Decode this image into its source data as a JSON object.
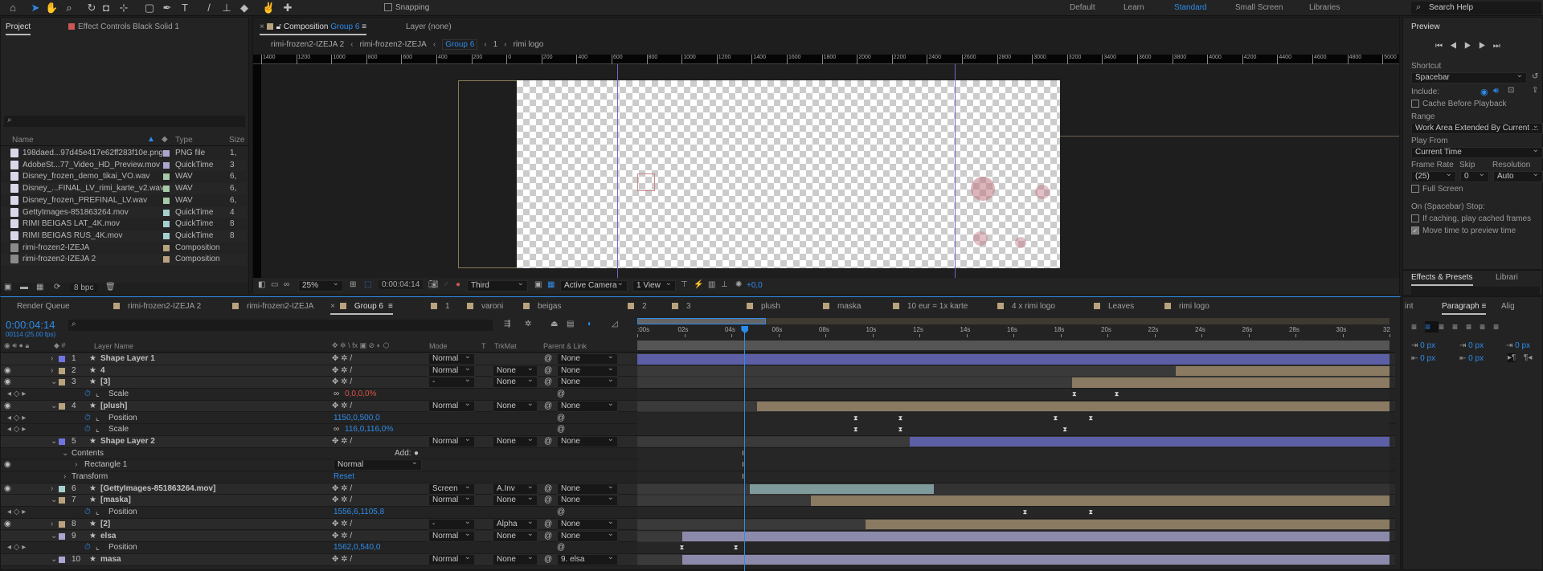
{
  "toolbar": {
    "snapping_label": "Snapping",
    "tools": [
      "home-icon",
      "selection-icon",
      "hand-icon",
      "zoom-icon",
      "rotate-icon",
      "camera-icon",
      "pan-behind-icon",
      "rectangle-icon",
      "pen-icon",
      "text-icon",
      "brush-icon",
      "clone-stamp-icon",
      "eraser-icon",
      "roto-brush-icon",
      "puppet-pin-icon"
    ],
    "workspaces": [
      "Default",
      "Learn",
      "Standard",
      "Small Screen",
      "Libraries"
    ],
    "active_workspace": "Standard",
    "search_placeholder": "Search Help"
  },
  "project": {
    "tab": "Project",
    "effect_controls_tab": "Effect Controls Black Solid 1",
    "columns": {
      "name": "Name",
      "type": "Type",
      "size": "Size"
    },
    "items": [
      {
        "name": "198daed...97d45e417e62ff283f10e.png",
        "type": "PNG file",
        "size": "1,",
        "color": "#a9a6d0",
        "icon": "image-file-icon"
      },
      {
        "name": "AdobeSt...77_Video_HD_Preview.mov",
        "type": "QuickTime",
        "size": "3",
        "color": "#a9a6d0",
        "icon": "video-file-icon"
      },
      {
        "name": "Disney_frozen_demo_tikai_VO.wav",
        "type": "WAV",
        "size": "6,",
        "color": "#a6c9a6",
        "icon": "audio-file-icon"
      },
      {
        "name": "Disney_...FINAL_LV_rimi_karte_v2.wav",
        "type": "WAV",
        "size": "6,",
        "color": "#a6c9a6",
        "icon": "audio-file-icon"
      },
      {
        "name": "Disney_frozen_PREFINAL_LV.wav",
        "type": "WAV",
        "size": "6,",
        "color": "#a6c9a6",
        "icon": "audio-file-icon"
      },
      {
        "name": "GettyImages-851863264.mov",
        "type": "QuickTime",
        "size": "4",
        "color": "#a6cfcf",
        "icon": "video-file-icon"
      },
      {
        "name": "RIMI BEIGAS LAT_4K.mov",
        "type": "QuickTime",
        "size": "8",
        "color": "#a6cfcf",
        "icon": "video-file-icon"
      },
      {
        "name": "RIMI BEIGAS RUS_4K.mov",
        "type": "QuickTime",
        "size": "8",
        "color": "#a6cfcf",
        "icon": "video-file-icon"
      },
      {
        "name": "rimi-frozen2-IZEJA",
        "type": "Composition",
        "size": "",
        "color": "#b9a37e",
        "icon": "composition-icon"
      },
      {
        "name": "rimi-frozen2-IZEJA 2",
        "type": "Composition",
        "size": "",
        "color": "#b9a37e",
        "icon": "composition-icon"
      }
    ],
    "bpc": "8 bpc"
  },
  "viewer": {
    "tab_prefix": "Composition",
    "tab_name": "Group 6",
    "layer_tab": "Layer (none)",
    "breadcrumbs": [
      "rimi-frozen2-IZEJA 2",
      "rimi-frozen2-IZEJA",
      "Group 6",
      "1",
      "rimi logo"
    ],
    "ruler": [
      "1400",
      "1200",
      "1000",
      "800",
      "600",
      "400",
      "200",
      "0",
      "200",
      "400",
      "600",
      "800",
      "1000",
      "1200",
      "1400",
      "1600",
      "1800",
      "2000",
      "2200",
      "2400",
      "2600",
      "2800",
      "3000",
      "3200",
      "3400",
      "3600",
      "3800",
      "4000",
      "4200",
      "4400",
      "4600",
      "4800",
      "5000"
    ],
    "zoom": "25%",
    "timecode": "0:00:04:14",
    "resolution": "Third",
    "camera": "Active Camera",
    "views": "1 View",
    "exposure": "+0,0"
  },
  "preview": {
    "title": "Preview",
    "shortcut_label": "Shortcut",
    "shortcut": "Spacebar",
    "include_label": "Include:",
    "cache_before": "Cache Before Playback",
    "range_label": "Range",
    "range": "Work Area Extended By Current ...",
    "play_from_label": "Play From",
    "play_from": "Current Time",
    "frame_rate_label": "Frame Rate",
    "skip_label": "Skip",
    "resolution_label": "Resolution",
    "frame_rate": "(25)",
    "skip": "0",
    "resolution": "Auto",
    "full_screen": "Full Screen",
    "stop_label": "On (Spacebar) Stop:",
    "if_caching": "If caching, play cached frames",
    "move_time": "Move time to preview time",
    "move_time_checked": true
  },
  "effects": {
    "tab": "Effects & Presets",
    "libraries_tab": "Librari"
  },
  "paragraph": {
    "paint_tab": "int",
    "tab": "Paragraph",
    "align_tab": "Alig",
    "indent_left": "0 px",
    "space_before": "0 px",
    "indent_first": "0 px",
    "indent_right": "0 px",
    "space_after": "0 px"
  },
  "timeline": {
    "tabs": [
      "Render Queue",
      "rimi-frozen2-IZEJA 2",
      "rimi-frozen2-IZEJA",
      "Group 6",
      "1",
      "varoni",
      "beigas",
      "2",
      "3",
      "plush",
      "maska",
      "10 eur = 1x karte",
      "4 x rimi logo",
      "Leaves",
      "rimi logo"
    ],
    "active_tab": "Group 6",
    "timecode": "0:00:04:14",
    "frames": "00114 (25.00 fps)",
    "current_time_s": 4.56,
    "duration_s": 32,
    "ticks": [
      ":00s",
      "02s",
      "04s",
      "06s",
      "08s",
      "10s",
      "12s",
      "14s",
      "16s",
      "18s",
      "20s",
      "22s",
      "24s",
      "26s",
      "28s",
      "30s",
      "32"
    ],
    "headers": {
      "layer_name": "Layer Name",
      "mode": "Mode",
      "t": "T",
      "trkmat": "TrkMat",
      "parent": "Parent & Link"
    },
    "colors": {
      "blue": "#5c5fa6",
      "tan": "#8a7a62",
      "teal": "#7e9a9a",
      "lavender": "#8c8aab",
      "playhead": "#2d8ceb"
    },
    "rows": [
      {
        "kind": "layer",
        "num": "1",
        "name": "Shape Layer 1",
        "label": "#6f74e0",
        "eye": false,
        "twirl": ">",
        "mode": "Normal",
        "trkmat": "",
        "parent": "None",
        "bar": {
          "start": 0,
          "color": "blue"
        }
      },
      {
        "kind": "layer",
        "num": "2",
        "name": "4",
        "label": "#b9a37e",
        "eye": true,
        "twirl": ">",
        "mode": "Normal",
        "trkmat": "None",
        "parent": "None",
        "bar": {
          "start": 22.9,
          "color": "tan"
        }
      },
      {
        "kind": "layer",
        "num": "3",
        "name": "[3]",
        "label": "#b9a37e",
        "eye": true,
        "twirl": "v",
        "mode": "-",
        "trkmat": "None",
        "parent": "None",
        "bar": {
          "start": 18.5,
          "color": "tan"
        }
      },
      {
        "kind": "prop",
        "name": "Scale",
        "value": "0,0,0,0%",
        "value_color": "#e0524a",
        "link": true,
        "keys": [
          18.6,
          20.4
        ]
      },
      {
        "kind": "layer",
        "num": "4",
        "name": "[plush]",
        "label": "#b9a37e",
        "eye": true,
        "twirl": "v",
        "mode": "Normal",
        "trkmat": "None",
        "parent": "None",
        "bar": {
          "start": 5.1,
          "color": "tan"
        }
      },
      {
        "kind": "prop",
        "name": "Position",
        "value": "1150,0,500,0",
        "value_color": "#2d8ceb",
        "keys": [
          9.3,
          11.2,
          17.8,
          19.3
        ]
      },
      {
        "kind": "prop",
        "name": "Scale",
        "value": "116,0,116,0%",
        "value_color": "#2d8ceb",
        "link": true,
        "keys": [
          9.3,
          11.2,
          18.2
        ]
      },
      {
        "kind": "layer",
        "num": "5",
        "name": "Shape Layer 2",
        "label": "#6f74e0",
        "eye": false,
        "twirl": "v",
        "mode": "Normal",
        "trkmat": "None",
        "parent": "None",
        "bar": {
          "start": 11.6,
          "color": "blue"
        }
      },
      {
        "kind": "group",
        "name": "Contents",
        "add": "Add:",
        "keys": [
          4.56
        ]
      },
      {
        "kind": "group2",
        "name": "Rectangle 1",
        "mode": "Normal",
        "keys": [
          4.56
        ]
      },
      {
        "kind": "group",
        "name": "Transform",
        "reset": "Reset",
        "keys": [
          4.56
        ]
      },
      {
        "kind": "layer",
        "num": "6",
        "name": "[GettyImages-851863264.mov]",
        "label": "#a6cfcf",
        "eye": true,
        "twirl": ">",
        "mode": "Screen",
        "trkmat": "A.Inv",
        "parent": "None",
        "bar": {
          "start": 4.8,
          "end": 12.6,
          "color": "teal"
        }
      },
      {
        "kind": "layer",
        "num": "7",
        "name": "[maska]",
        "label": "#b9a37e",
        "eye": false,
        "twirl": "v",
        "mode": "Normal",
        "trkmat": "None",
        "parent": "None",
        "bar": {
          "start": 7.4,
          "color": "tan"
        }
      },
      {
        "kind": "prop",
        "name": "Position",
        "value": "1556,6,1105,8",
        "value_color": "#2d8ceb",
        "keys": [
          16.5,
          19.3
        ]
      },
      {
        "kind": "layer",
        "num": "8",
        "name": "[2]",
        "label": "#b9a37e",
        "eye": true,
        "twirl": ">",
        "mode": "-",
        "trkmat": "Alpha",
        "parent": "None",
        "bar": {
          "start": 9.7,
          "color": "tan"
        }
      },
      {
        "kind": "layer",
        "num": "9",
        "name": "elsa",
        "label": "#a9a6d0",
        "eye": false,
        "twirl": "v",
        "mode": "Normal",
        "trkmat": "None",
        "parent": "None",
        "bar": {
          "start": 1.9,
          "color": "lavender"
        }
      },
      {
        "kind": "prop",
        "name": "Position",
        "value": "1562,0,540,0",
        "value_color": "#2d8ceb",
        "keys": [
          1.9,
          4.2
        ]
      },
      {
        "kind": "layer",
        "num": "10",
        "name": "masa",
        "label": "#a9a6d0",
        "eye": false,
        "twirl": "v",
        "mode": "Normal",
        "trkmat": "None",
        "parent": "9. elsa",
        "bar": {
          "start": 1.9,
          "color": "lavender"
        }
      }
    ]
  }
}
